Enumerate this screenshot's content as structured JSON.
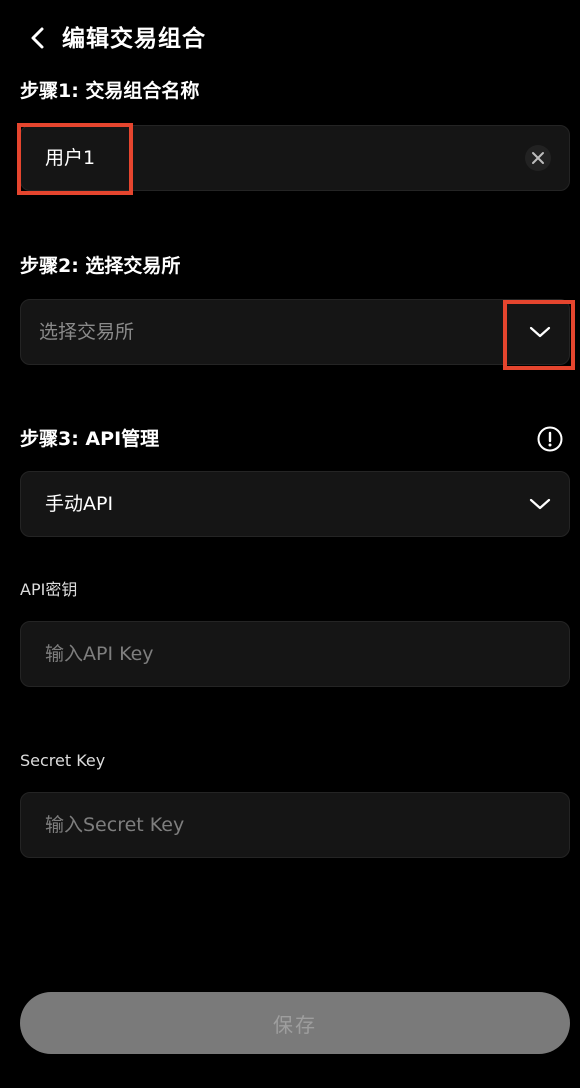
{
  "header": {
    "title": "编辑交易组合"
  },
  "step1": {
    "label": "步骤1: 交易组合名称",
    "value": "用户1"
  },
  "step2": {
    "label": "步骤2: 选择交易所",
    "placeholder": "选择交易所"
  },
  "step3": {
    "label": "步骤3: API管理",
    "api_mode": "手动API"
  },
  "api_key": {
    "label": "API密钥",
    "placeholder": "输入API Key"
  },
  "secret_key": {
    "label": "Secret Key",
    "placeholder": "输入Secret Key"
  },
  "save_button": {
    "label": "保存"
  },
  "colors": {
    "background": "#000000",
    "field_bg": "#151515",
    "highlight": "#e5452e",
    "save_bg": "#7a7a7a"
  },
  "icons": {
    "back": "chevron-left-icon",
    "clear": "close-icon",
    "dropdown": "chevron-down-icon",
    "info": "info-icon"
  }
}
